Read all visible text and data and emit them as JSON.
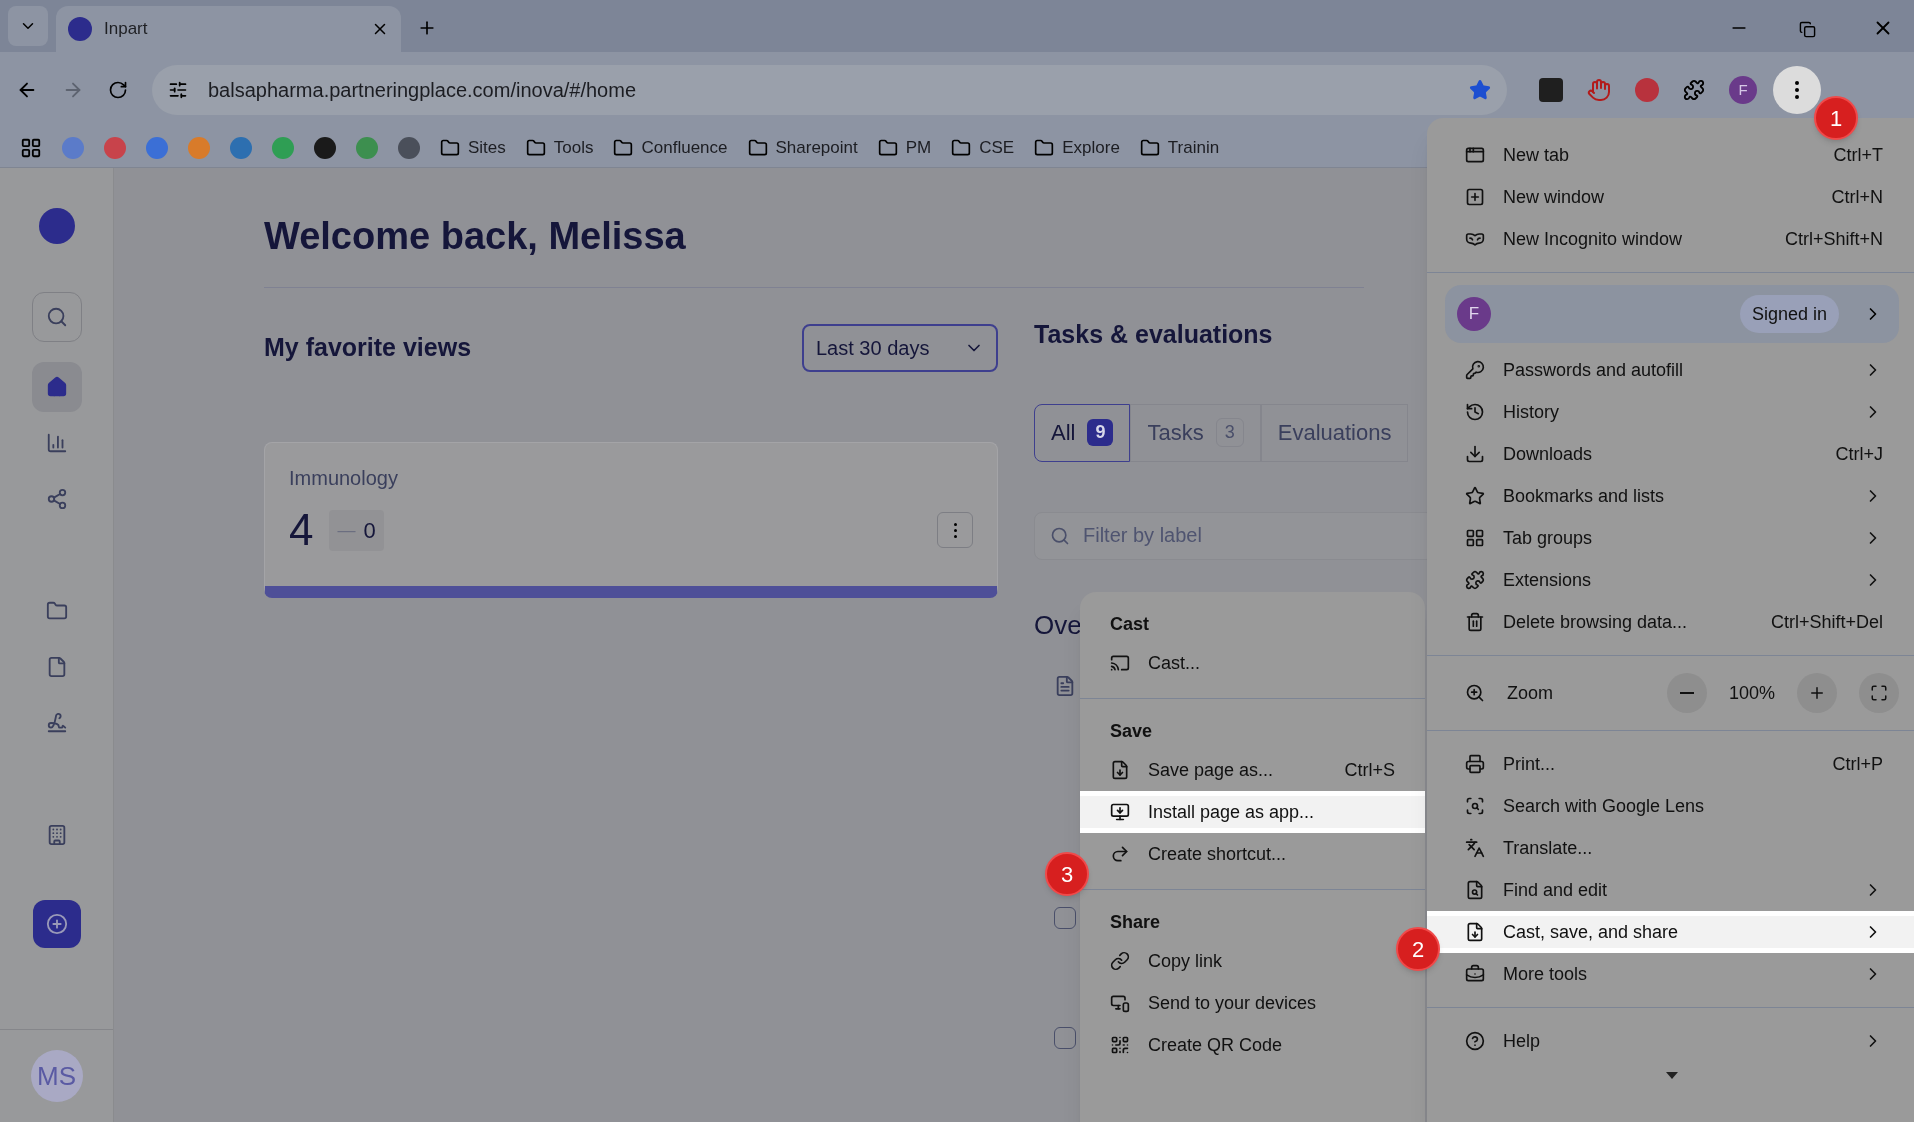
{
  "browser": {
    "tab_title": "Inpart",
    "url": "balsapharma.partneringplace.com/inova/#/home",
    "profile_initial": "F",
    "bookmark_folders": [
      "Sites",
      "Tools",
      "Confluence",
      "Sharepoint",
      "PM",
      "CSE",
      "Explore",
      "Trainin"
    ]
  },
  "sidebar": {
    "items": [
      {
        "kind": "search",
        "selected": false
      },
      {
        "kind": "home",
        "selected": true
      },
      {
        "kind": "chart",
        "selected": false
      },
      {
        "kind": "share",
        "selected": false
      },
      {
        "kind": "folder",
        "selected": false
      },
      {
        "kind": "file",
        "selected": false
      },
      {
        "kind": "signature",
        "selected": false
      },
      {
        "kind": "building",
        "selected": false
      }
    ],
    "avatar": "MS"
  },
  "main": {
    "title": "Welcome back, Melissa",
    "favorites": {
      "title": "My favorite views",
      "range": "Last 30 days",
      "card": {
        "label": "Immunology",
        "value": "4",
        "dash": "—",
        "change": "0"
      }
    },
    "tasks": {
      "title": "Tasks & evaluations",
      "tabs": [
        {
          "label": "All",
          "count": "9",
          "selected": true
        },
        {
          "label": "Tasks",
          "count": "3",
          "selected": false
        },
        {
          "label": "Evaluations",
          "selected": false
        }
      ],
      "filter_placeholder": "Filter by label",
      "overview_heading": "Ove",
      "checkboxes": [
        {
          "checked": false
        },
        {
          "checked": false
        }
      ]
    }
  },
  "submenu": {
    "items": [
      {
        "kind": "heading",
        "label": "Cast"
      },
      {
        "kind": "item",
        "label": "Cast...",
        "highlighted": false
      },
      {
        "kind": "divider"
      },
      {
        "kind": "heading",
        "label": "Save"
      },
      {
        "kind": "item",
        "label": "Save page as...",
        "shortcut": "Ctrl+S",
        "highlighted": false
      },
      {
        "kind": "item",
        "label": "Install page as app...",
        "highlighted": true
      },
      {
        "kind": "item",
        "label": "Create shortcut...",
        "highlighted": false
      },
      {
        "kind": "divider"
      },
      {
        "kind": "heading",
        "label": "Share"
      },
      {
        "kind": "item",
        "label": "Copy link",
        "highlighted": false
      },
      {
        "kind": "item",
        "label": "Send to your devices",
        "highlighted": false
      },
      {
        "kind": "item",
        "label": "Create QR Code",
        "highlighted": false
      }
    ]
  },
  "chrome_menu": {
    "items": [
      {
        "kind": "item",
        "label": "New tab",
        "shortcut": "Ctrl+T",
        "submenu": false,
        "highlighted": false
      },
      {
        "kind": "item",
        "label": "New window",
        "shortcut": "Ctrl+N",
        "submenu": false,
        "highlighted": false
      },
      {
        "kind": "item",
        "label": "New Incognito window",
        "shortcut": "Ctrl+Shift+N",
        "submenu": false,
        "highlighted": false
      },
      {
        "kind": "divider"
      },
      {
        "kind": "profile",
        "initial": "F",
        "status": "Signed in"
      },
      {
        "kind": "item",
        "label": "Passwords and autofill",
        "submenu": true,
        "highlighted": false
      },
      {
        "kind": "item",
        "label": "History",
        "submenu": true,
        "highlighted": false
      },
      {
        "kind": "item",
        "label": "Downloads",
        "shortcut": "Ctrl+J",
        "submenu": false,
        "highlighted": false
      },
      {
        "kind": "item",
        "label": "Bookmarks and lists",
        "submenu": true,
        "highlighted": false
      },
      {
        "kind": "item",
        "label": "Tab groups",
        "submenu": true,
        "highlighted": false
      },
      {
        "kind": "item",
        "label": "Extensions",
        "submenu": true,
        "highlighted": false
      },
      {
        "kind": "item",
        "label": "Delete browsing data...",
        "shortcut": "Ctrl+Shift+Del",
        "submenu": false,
        "highlighted": false
      },
      {
        "kind": "divider"
      },
      {
        "kind": "zoom",
        "label": "Zoom",
        "value": "100%"
      },
      {
        "kind": "divider"
      },
      {
        "kind": "item",
        "label": "Print...",
        "shortcut": "Ctrl+P",
        "submenu": false,
        "highlighted": false
      },
      {
        "kind": "item",
        "label": "Search with Google Lens",
        "submenu": false,
        "highlighted": false
      },
      {
        "kind": "item",
        "label": "Translate...",
        "submenu": false,
        "highlighted": false
      },
      {
        "kind": "item",
        "label": "Find and edit",
        "submenu": true,
        "highlighted": false
      },
      {
        "kind": "item",
        "label": "Cast, save, and share",
        "submenu": true,
        "highlighted": true
      },
      {
        "kind": "item",
        "label": "More tools",
        "submenu": true,
        "highlighted": false
      },
      {
        "kind": "divider"
      },
      {
        "kind": "item",
        "label": "Help",
        "submenu": true,
        "highlighted": false
      }
    ]
  },
  "step_badges": [
    {
      "label": "1"
    },
    {
      "label": "2"
    },
    {
      "label": "3"
    }
  ]
}
